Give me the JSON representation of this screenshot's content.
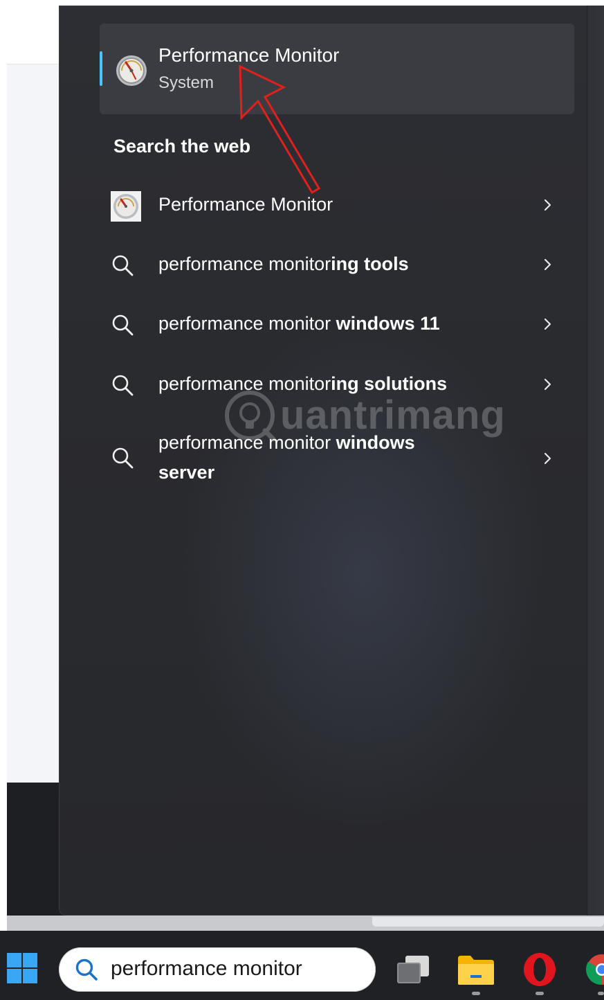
{
  "best_match": {
    "title": "Performance Monitor",
    "subtitle": "System",
    "icon": "performance-monitor-gauge-icon"
  },
  "web_section": {
    "heading": "Search the web",
    "items": [
      {
        "icon": "performance-monitor-gauge-icon",
        "normal": "Performance Monitor",
        "bold": ""
      },
      {
        "icon": "search-icon",
        "normal": "performance monitor",
        "bold": "ing tools"
      },
      {
        "icon": "search-icon",
        "normal": "performance monitor ",
        "bold": "windows 11"
      },
      {
        "icon": "search-icon",
        "normal": "performance monitor",
        "bold": "ing solutions"
      },
      {
        "icon": "search-icon",
        "normal": "performance monitor ",
        "bold": "windows server"
      }
    ]
  },
  "watermark": {
    "text": "uantrimang"
  },
  "taskbar": {
    "search_value": "performance monitor",
    "icons": [
      "start-icon",
      "task-view-icon",
      "file-explorer-icon",
      "opera-browser-icon",
      "chrome-browser-icon"
    ]
  },
  "colors": {
    "accent": "#4cc2ff",
    "flyout_bg": "#2a2b2f",
    "annotation_arrow": "#e0201c"
  }
}
